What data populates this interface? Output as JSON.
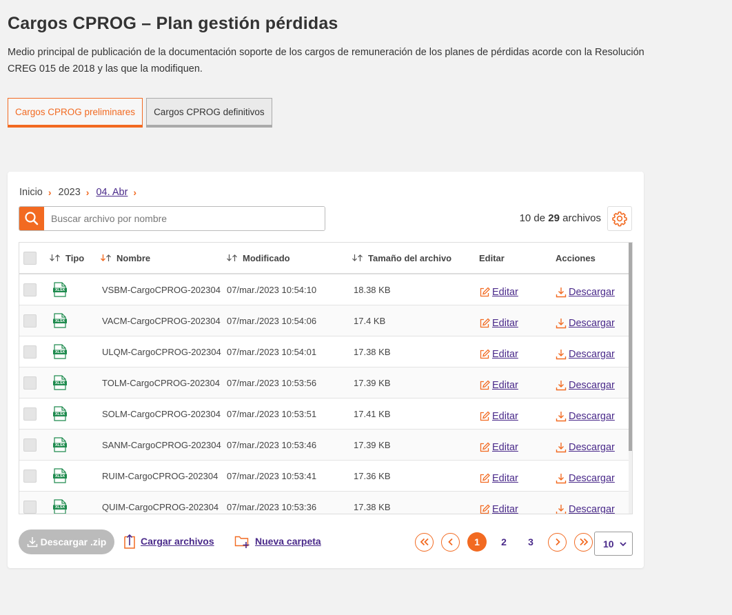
{
  "page": {
    "title": "Cargos CPROG – Plan gestión pérdidas",
    "description": "Medio principal de publicación de la documentación soporte de los cargos de remuneración de los planes de pérdidas acorde con la Resolución CREG 015 de 2018 y las que la modifiquen."
  },
  "tabs": [
    {
      "label": "Cargos CPROG preliminares",
      "active": true
    },
    {
      "label": "Cargos CPROG definitivos",
      "active": false
    }
  ],
  "breadcrumb": [
    "Inicio",
    "2023",
    "04. Abr"
  ],
  "search": {
    "placeholder": "Buscar archivo por nombre"
  },
  "count": {
    "shown": "10",
    "of_label": "de",
    "total": "29",
    "unit": "archivos"
  },
  "table": {
    "headers": {
      "tipo": "Tipo",
      "nombre": "Nombre",
      "modificado": "Modificado",
      "tamano": "Tamaño del archivo",
      "editar": "Editar",
      "acciones": "Acciones"
    },
    "edit_label": "Editar",
    "download_label": "Descargar",
    "file_type": "XLSX",
    "rows": [
      {
        "name": "VSBM-CargoCPROG-202304",
        "modified": "07/mar./2023 10:54:10",
        "size": "18.38 KB"
      },
      {
        "name": "VACM-CargoCPROG-202304",
        "modified": "07/mar./2023 10:54:06",
        "size": "17.4 KB"
      },
      {
        "name": "ULQM-CargoCPROG-202304",
        "modified": "07/mar./2023 10:54:01",
        "size": "17.38 KB"
      },
      {
        "name": "TOLM-CargoCPROG-202304",
        "modified": "07/mar./2023 10:53:56",
        "size": "17.39 KB"
      },
      {
        "name": "SOLM-CargoCPROG-202304",
        "modified": "07/mar./2023 10:53:51",
        "size": "17.41 KB"
      },
      {
        "name": "SANM-CargoCPROG-202304",
        "modified": "07/mar./2023 10:53:46",
        "size": "17.39 KB"
      },
      {
        "name": "RUIM-CargoCPROG-202304",
        "modified": "07/mar./2023 10:53:41",
        "size": "17.36 KB"
      },
      {
        "name": "QUIM-CargoCPROG-202304",
        "modified": "07/mar./2023 10:53:36",
        "size": "17.38 KB"
      }
    ]
  },
  "footer": {
    "zip_label": "Descargar .zip",
    "upload_label": "Cargar archivos",
    "new_folder_label": "Nueva carpeta",
    "pages": [
      "1",
      "2",
      "3"
    ],
    "current_page": "1",
    "per_page": "10"
  },
  "colors": {
    "accent": "#f26a21",
    "link": "#4a2a8a",
    "excel_green": "#1d8a4d"
  }
}
